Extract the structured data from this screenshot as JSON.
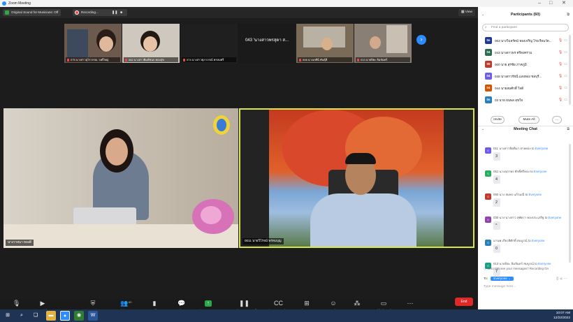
{
  "window": {
    "title": "Zoom Meeting"
  },
  "topbar": {
    "sound_label": "Original Sound for Musicians: Off",
    "recording_label": "Recording...",
    "pause_icon": "pause-icon",
    "stop_icon": "stop-icon",
    "view_label": "View"
  },
  "gallery": {
    "thumbs": [
      {
        "name": "075 นางสาวอุไรวรรณ วงศ์ใหญ่"
      },
      {
        "name": "062 นางสาวพิมพ์ชนก ทองสุข"
      },
      {
        "name": "074 นางสาวศุภาภรณ์ พรหมศรี"
      },
      {
        "name": "043 นางสาวพรสุดา ศรีสงคราม",
        "display": "043 'นางสาวพรสุดา ส..."
      },
      {
        "name": "008 นางเกศินี พันธุ์ดี"
      },
      {
        "name": "013 นายปิยะ ลิมจันทร์"
      }
    ]
  },
  "main_video": {
    "left_name": "นางวาสนา ทองดี",
    "right_name": "0011 นายวิโรจน์ พรหมบุญ"
  },
  "toolbar": {
    "items": [
      {
        "label": "Mute",
        "icon": "microphone-icon"
      },
      {
        "label": "Stop Video",
        "icon": "video-camera-icon"
      },
      {
        "label": "Security",
        "icon": "shield-icon"
      },
      {
        "label": "Participants",
        "icon": "participants-icon",
        "count": "60"
      },
      {
        "label": "Polls",
        "icon": "polls-icon"
      },
      {
        "label": "Chat",
        "icon": "chat-icon"
      },
      {
        "label": "Share Screen",
        "icon": "share-screen-icon"
      },
      {
        "label": "Pause/Stop Recording",
        "icon": "recording-icon"
      },
      {
        "label": "Live Transcript",
        "icon": "cc-icon"
      },
      {
        "label": "Breakout Rooms",
        "icon": "breakout-rooms-icon"
      },
      {
        "label": "Reactions",
        "icon": "reactions-icon"
      },
      {
        "label": "Apps",
        "icon": "apps-icon"
      },
      {
        "label": "Whiteboards",
        "icon": "whiteboard-icon"
      },
      {
        "label": "More",
        "icon": "more-icon"
      }
    ],
    "end_label": "End"
  },
  "participants_panel": {
    "title": "Participants (60)",
    "search_placeholder": "Find a participant",
    "list": [
      {
        "initials": "0e",
        "color": "#1f3a93",
        "name": "063 นางวิมลรัตน์ ทองเจริญ โรงเรียนวัด..."
      },
      {
        "initials": "04",
        "color": "#2d6a4f",
        "name": "043 นางสาวพร ศรีสงคราม"
      },
      {
        "initials": "00",
        "color": "#c0392b",
        "name": "000 นาย สุรชัย ภาคภูมิ"
      },
      {
        "initials": "04",
        "color": "#6c5ce7",
        "name": "048 นางสาวรัชนี แสงทอง ชลบุรี..."
      },
      {
        "initials": "04",
        "color": "#d35400",
        "name": "044 นายสมศักดิ์ ใจดี"
      },
      {
        "initials": "0s",
        "color": "#2980b9",
        "name": "03 นาย ธนพล สุขใจ"
      }
    ],
    "invite_label": "Invite",
    "mute_all_label": "Mute All",
    "more_label": "..."
  },
  "chat_panel": {
    "title": "Meeting Chat",
    "messages": [
      {
        "initials": "0",
        "color": "#6c5ce7",
        "from": "011 นางสาวจิตติมา สายทอง",
        "to": "Everyone",
        "body": "3"
      },
      {
        "initials": "0",
        "color": "#27ae60",
        "from": "051 นางสุภาพร ศักดิ์ศรีทอง",
        "to": "Everyone",
        "body": "4"
      },
      {
        "initials": "0",
        "color": "#c0392b",
        "from": "050 นาง สมพร แก้วมณี",
        "to": "Everyone",
        "body": "2"
      },
      {
        "initials": "0",
        "color": "#8e44ad",
        "from": "030 นาง นางสาว สุพัตรา ทองประเสริฐ",
        "to": "Everyone",
        "body": "^"
      },
      {
        "initials": "0",
        "color": "#2980b9",
        "from": "มานพ เกียรติศักดิ์ สมบูรณ์",
        "to": "Everyone",
        "body": "0"
      },
      {
        "initials": "0",
        "color": "#16a085",
        "from": "013 นายปิยะ ลิมจันทร์ สมบูรณ์",
        "to": "Everyone",
        "body": "7"
      }
    ],
    "who_can_see": "Who can see your messages? Recording On",
    "to_label": "To:",
    "to_value": "Everyone",
    "input_placeholder": "Type message here..."
  },
  "taskbar": {
    "time": "10:07 AM",
    "date": "12/22/2022"
  }
}
